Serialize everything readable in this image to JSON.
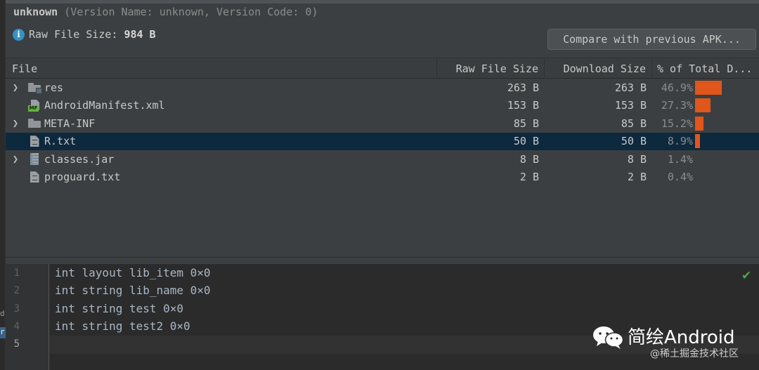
{
  "header": {
    "app_name": "unknown",
    "version_info": "(Version Name: unknown, Version Code: 0)",
    "raw_file_size_label": "Raw File Size:",
    "raw_file_size_value": "984 B",
    "compare_button": "Compare with previous APK..."
  },
  "table": {
    "columns": [
      "File",
      "Raw File Size",
      "Download Size",
      "% of Total D..."
    ],
    "rows": [
      {
        "name": "res",
        "icon": "folder-icon",
        "expandable": true,
        "raw": "263 B",
        "download": "263 B",
        "percent": "46.9%",
        "fraction": 0.469,
        "selected": false
      },
      {
        "name": "AndroidManifest.xml",
        "icon": "manifest-file-icon",
        "expandable": false,
        "raw": "153 B",
        "download": "153 B",
        "percent": "27.3%",
        "fraction": 0.273,
        "selected": false
      },
      {
        "name": "META-INF",
        "icon": "folder-icon",
        "expandable": true,
        "raw": "85 B",
        "download": "85 B",
        "percent": "15.2%",
        "fraction": 0.152,
        "selected": false
      },
      {
        "name": "R.txt",
        "icon": "text-file-icon",
        "expandable": false,
        "raw": "50 B",
        "download": "50 B",
        "percent": "8.9%",
        "fraction": 0.089,
        "selected": true
      },
      {
        "name": "classes.jar",
        "icon": "jar-file-icon",
        "expandable": true,
        "raw": "8 B",
        "download": "8 B",
        "percent": "1.4%",
        "fraction": 0.014,
        "selected": false
      },
      {
        "name": "proguard.txt",
        "icon": "text-file-icon",
        "expandable": false,
        "raw": "2 B",
        "download": "2 B",
        "percent": "0.4%",
        "fraction": 0.004,
        "selected": false
      }
    ]
  },
  "editor": {
    "lines": [
      {
        "num": "1",
        "text": "int layout lib_item 0×0"
      },
      {
        "num": "2",
        "text": "int string lib_name 0×0"
      },
      {
        "num": "3",
        "text": "int string test 0×0"
      },
      {
        "num": "4",
        "text": "int string test2 0×0"
      },
      {
        "num": "5",
        "text": ""
      }
    ],
    "status_icon": "check-icon"
  },
  "left_strip": {
    "marks": [
      "d",
      "r"
    ]
  },
  "watermark": {
    "title": "简绘Android",
    "subtitle": "@稀土掘金技术社区",
    "logo": "wechat-logo"
  },
  "colors": {
    "bar": "#e0561b",
    "selected_row": "#0d293e",
    "check": "#4aa84b",
    "info": "#3592c4"
  }
}
